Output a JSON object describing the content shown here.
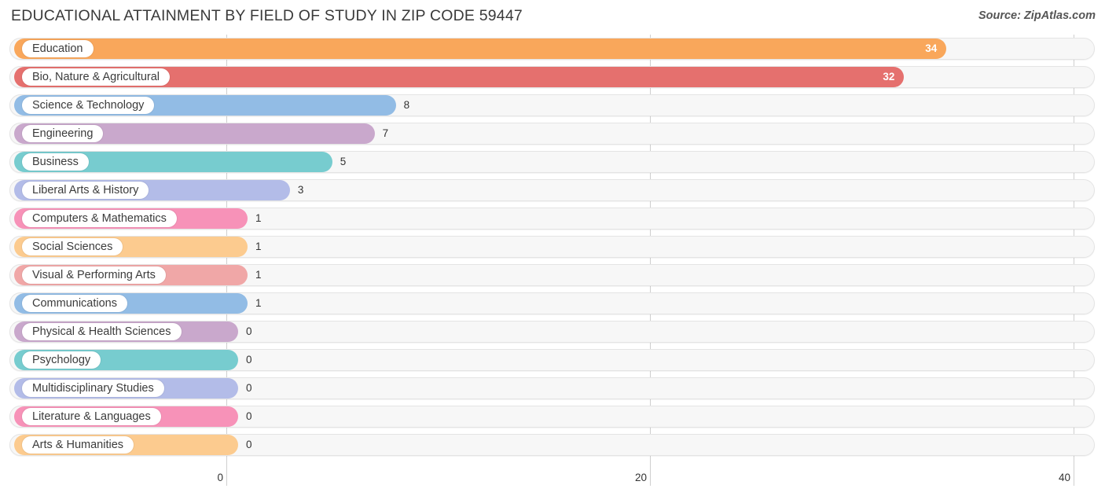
{
  "header": {
    "title": "EDUCATIONAL ATTAINMENT BY FIELD OF STUDY IN ZIP CODE 59447",
    "source": "Source: ZipAtlas.com"
  },
  "chart_data": {
    "type": "bar",
    "orientation": "horizontal",
    "title": "EDUCATIONAL ATTAINMENT BY FIELD OF STUDY IN ZIP CODE 59447",
    "xlabel": "",
    "ylabel": "",
    "xlim": [
      0,
      40
    ],
    "ticks": [
      "0",
      "20",
      "40"
    ],
    "tick_values": [
      0,
      20,
      40
    ],
    "grid": true,
    "legend": "none",
    "categories": [
      "Education",
      "Bio, Nature & Agricultural",
      "Science & Technology",
      "Engineering",
      "Business",
      "Liberal Arts & History",
      "Computers & Mathematics",
      "Social Sciences",
      "Visual & Performing Arts",
      "Communications",
      "Physical & Health Sciences",
      "Psychology",
      "Multidisciplinary Studies",
      "Literature & Languages",
      "Arts & Humanities"
    ],
    "values": [
      34,
      32,
      8,
      7,
      5,
      3,
      1,
      1,
      1,
      1,
      0,
      0,
      0,
      0,
      0
    ],
    "value_labels": [
      "34",
      "32",
      "8",
      "7",
      "5",
      "3",
      "1",
      "1",
      "1",
      "1",
      "0",
      "0",
      "0",
      "0",
      "0"
    ],
    "colors": [
      "#f9a75b",
      "#e5706e",
      "#92bce5",
      "#c9a8cc",
      "#77cccf",
      "#b3bce8",
      "#f792b8",
      "#fccb8f",
      "#f0a7a7",
      "#92bce5",
      "#c9a8cc",
      "#77cccf",
      "#b3bce8",
      "#f792b8",
      "#fccb8f"
    ]
  }
}
